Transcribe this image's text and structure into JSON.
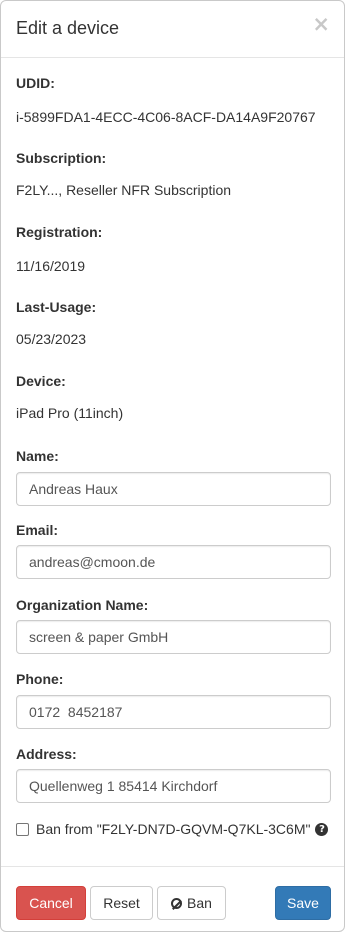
{
  "modal": {
    "title": "Edit a device",
    "close_label": "×"
  },
  "info": {
    "udid_label": "UDID:",
    "udid_value": "i-5899FDA1-4ECC-4C06-8ACF-DA14A9F20767",
    "subscription_label": "Subscription:",
    "subscription_value": "F2LY..., Reseller NFR Subscription",
    "registration_label": "Registration:",
    "registration_value": "11/16/2019",
    "last_usage_label": "Last-Usage:",
    "last_usage_value": "05/23/2023",
    "device_label": "Device:",
    "device_value": "iPad Pro (11inch)"
  },
  "form": {
    "name_label": "Name:",
    "name_value": "Andreas Haux",
    "email_label": "Email:",
    "email_value": "andreas@cmoon.de",
    "organization_label": "Organization Name:",
    "organization_value": "screen & paper GmbH",
    "phone_label": "Phone:",
    "phone_value": "0172  8452187",
    "address_label": "Address:",
    "address_value": "Quellenweg 1 85414 Kirchdorf",
    "ban_checkbox_label": "Ban from \"F2LY-DN7D-GQVM-Q7KL-3C6M\"",
    "help_icon_glyph": "?"
  },
  "footer": {
    "cancel_label": "Cancel",
    "reset_label": "Reset",
    "ban_label": "Ban",
    "save_label": "Save"
  },
  "colors": {
    "danger": "#d9534f",
    "primary": "#337ab7"
  }
}
